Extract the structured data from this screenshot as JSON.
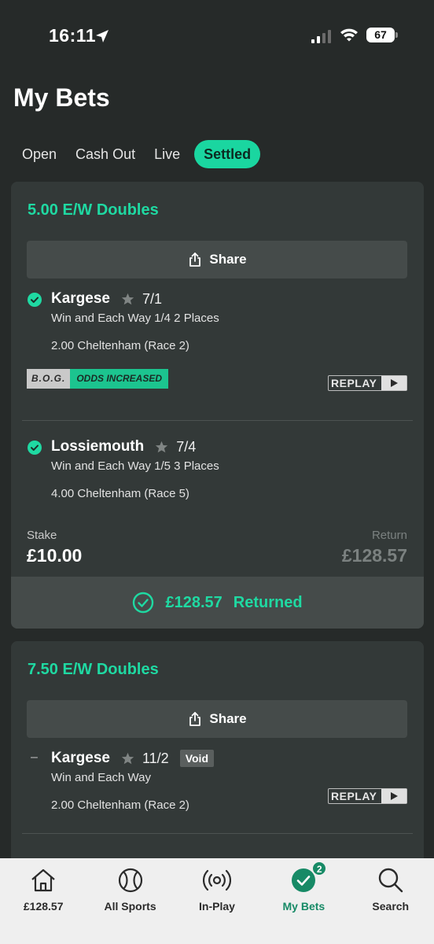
{
  "status_bar": {
    "time": "16:11",
    "battery": "67"
  },
  "page": {
    "title": "My Bets"
  },
  "tabs": [
    {
      "label": "Open"
    },
    {
      "label": "Cash Out"
    },
    {
      "label": "Live"
    },
    {
      "label": "Settled",
      "active": true
    }
  ],
  "bets": [
    {
      "title": "5.00 E/W Doubles",
      "share_label": "Share",
      "selections": [
        {
          "name": "Kargese",
          "odds": "7/1",
          "market": "Win and Each Way 1/4 2 Places",
          "race": "2.00 Cheltenham (Race 2)",
          "status_icon": "check-circle-icon",
          "badge_left": "B.O.G.",
          "badge_right": "ODDS INCREASED",
          "replay_label": "REPLAY"
        },
        {
          "name": "Lossiemouth",
          "odds": "7/4",
          "market": "Win and Each Way 1/5 3 Places",
          "race": "4.00 Cheltenham (Race 5)",
          "status_icon": "check-circle-icon"
        }
      ],
      "stake_label": "Stake",
      "stake_value": "£10.00",
      "return_label": "Return",
      "return_value": "£128.57",
      "returned_amount": "£128.57",
      "returned_label": "Returned"
    },
    {
      "title": "7.50 E/W Doubles",
      "share_label": "Share",
      "selections": [
        {
          "name": "Kargese",
          "odds": "11/2",
          "void_label": "Void",
          "market": "Win and Each Way",
          "race": "2.00 Cheltenham (Race 2)",
          "status_icon": "dash-icon",
          "replay_label": "REPLAY"
        }
      ]
    }
  ],
  "bottom_nav": [
    {
      "label": "£128.57",
      "icon": "home-icon"
    },
    {
      "label": "All Sports",
      "icon": "ball-icon"
    },
    {
      "label": "In-Play",
      "icon": "broadcast-icon"
    },
    {
      "label": "My Bets",
      "icon": "check-circle-icon",
      "badge": "2",
      "active": true
    },
    {
      "label": "Search",
      "icon": "search-icon"
    }
  ],
  "colors": {
    "background": "#262a29",
    "card": "#333938",
    "accent_green": "#1fd9a2",
    "active_tab": "#1ad6a0",
    "nav_active": "#178a66"
  }
}
